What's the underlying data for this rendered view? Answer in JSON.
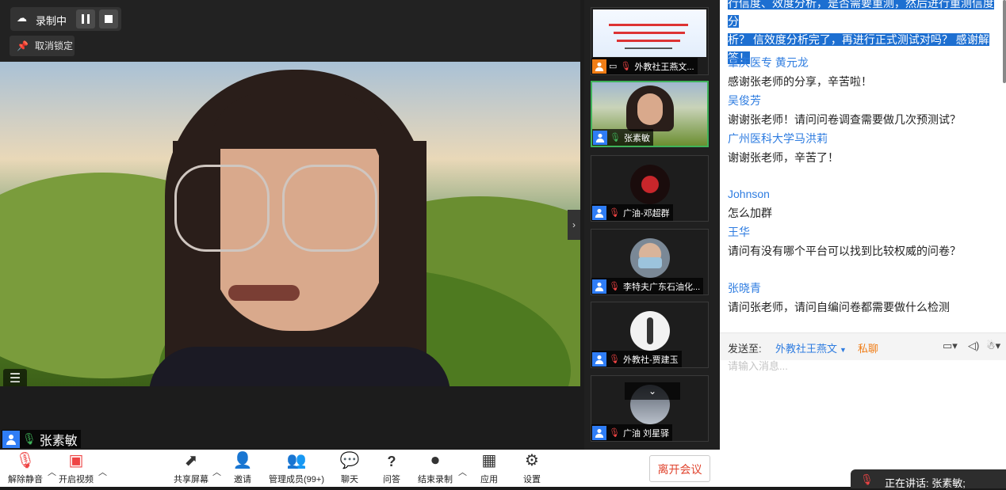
{
  "recording": {
    "status": "录制中"
  },
  "unlock": {
    "label": "取消锁定"
  },
  "speaker": {
    "name": "张素敏"
  },
  "thumbnails": [
    {
      "label": "外教社王燕文..."
    },
    {
      "label": "张素敏"
    },
    {
      "label": "广油-邓超群"
    },
    {
      "label": "李特夫广东石油化..."
    },
    {
      "label": "外教社-贾建玉"
    },
    {
      "label": "广油 刘星驿"
    }
  ],
  "chat": {
    "messages": [
      {
        "text_lines": [
          "行信度、效度分析，是否需要重测，然后进行重测信度分",
          "析？ 信效度分析完了，再进行正式测试对吗？ 感谢解",
          "答！"
        ]
      },
      {
        "sender": "肇庆医专 黄元龙",
        "text": "感谢张老师的分享，辛苦啦！"
      },
      {
        "sender": "吴俊芳",
        "text": "谢谢张老师！请问问卷调查需要做几次预测试？"
      },
      {
        "sender": "广州医科大学马洪莉",
        "text": "谢谢张老师，辛苦了！"
      },
      {
        "sender": "Johnson",
        "text": "怎么加群"
      },
      {
        "sender": "王华",
        "text": "请问有没有哪个平台可以找到比较权威的问卷？"
      },
      {
        "sender": "张晓青",
        "text": "请问张老师，请问自编问卷都需要做什么检测"
      }
    ],
    "send_to_label": "发送至:",
    "send_to_value": "外教社王燕文",
    "private_label": "私聊",
    "input_placeholder": "请输入消息...",
    "speaking_label": "正在讲话: 张素敏;"
  },
  "toolbar": {
    "unmute": "解除静音",
    "start_video": "开启视频",
    "share_screen": "共享屏幕",
    "invite": "邀请",
    "manage": "管理成员(99+)",
    "chat": "聊天",
    "qa": "问答",
    "stop_record": "结束录制",
    "apps": "应用",
    "settings": "设置",
    "leave": "离开会议"
  },
  "colors": {
    "accent": "#2e7ce0",
    "leave": "#e0442e",
    "active_border": "#3fb35a",
    "selection": "#1d6fd1"
  }
}
